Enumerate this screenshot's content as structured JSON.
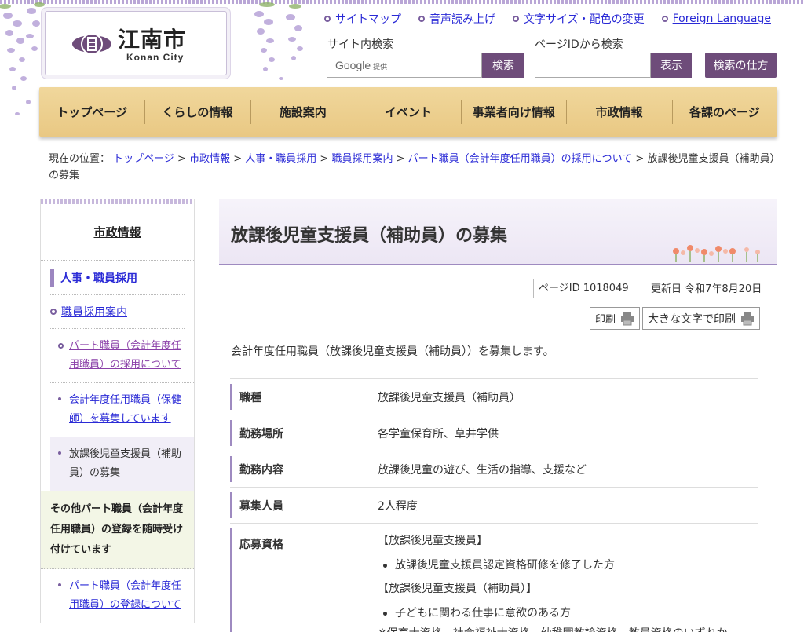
{
  "header": {
    "logo": {
      "name_jp": "江南市",
      "name_en": "Konan City"
    },
    "utility_links": [
      {
        "label": "サイトマップ"
      },
      {
        "label": "音声読み上げ"
      },
      {
        "label": "文字サイズ・配色の変更"
      },
      {
        "label": "Foreign Language"
      }
    ],
    "site_search": {
      "label": "サイト内検索",
      "provider": "Google",
      "provider_note": "提供",
      "button": "検索"
    },
    "page_id_search": {
      "label": "ページIDから検索",
      "button": "表示"
    },
    "search_help_button": "検索の仕方"
  },
  "global_nav": [
    {
      "label": "トップページ"
    },
    {
      "label": "くらしの情報"
    },
    {
      "label": "施設案内"
    },
    {
      "label": "イベント"
    },
    {
      "label": "事業者向け情報"
    },
    {
      "label": "市政情報"
    },
    {
      "label": "各課のページ"
    }
  ],
  "breadcrumb": {
    "prefix": "現在の位置：",
    "links": [
      "トップページ",
      "市政情報",
      "人事・職員採用",
      "職員採用案内",
      "パート職員（会計年度任用職員）の採用について"
    ],
    "separator": " > ",
    "current": "放課後児童支援員（補助員）の募集"
  },
  "sidebar": {
    "title": "市政情報",
    "category": "人事・職員採用",
    "subcategory": "職員採用案内",
    "items": [
      {
        "label": "パート職員（会計年度任用職員）の採用について"
      },
      {
        "label": "会計年度任用職員（保健師）を募集しています"
      },
      {
        "label": "放課後児童支援員（補助員）の募集"
      }
    ],
    "group_heading": "その他パート職員（会計年度任用職員）の登録を随時受け付けています",
    "group_items": [
      {
        "label": "パート職員（会計年度任用職員）の登録について"
      }
    ]
  },
  "main": {
    "title": "放課後児童支援員（補助員）の募集",
    "page_id": "ページID 1018049",
    "updated": "更新日 令和7年8月20日",
    "print_label": "印刷",
    "print_large_label": "大きな文字で印刷",
    "intro": "会計年度任用職員（放課後児童支援員（補助員））を募集します。",
    "details": [
      {
        "th": "職種",
        "td": "放課後児童支援員（補助員）"
      },
      {
        "th": "勤務場所",
        "td": "各学童保育所、草井学供"
      },
      {
        "th": "勤務内容",
        "td": "放課後児童の遊び、生活の指導、支援など"
      },
      {
        "th": "募集人員",
        "td": "2人程度"
      }
    ],
    "qualification": {
      "th": "応募資格",
      "head1": "【放課後児童支援員】",
      "item1": "放課後児童支援員認定資格研修を修了した方",
      "head2": "【放課後児童支援員（補助員）】",
      "item2": "子どもに関わる仕事に意欲のある方"
    },
    "cut_text": "※保育士資格、社会福祉士資格、幼稚園教諭資格、教員資格のいずれか"
  },
  "colors": {
    "accent_purple": "#6e4c7a",
    "nav_gold": "#ecd08f",
    "link": "#2a2ad6"
  }
}
